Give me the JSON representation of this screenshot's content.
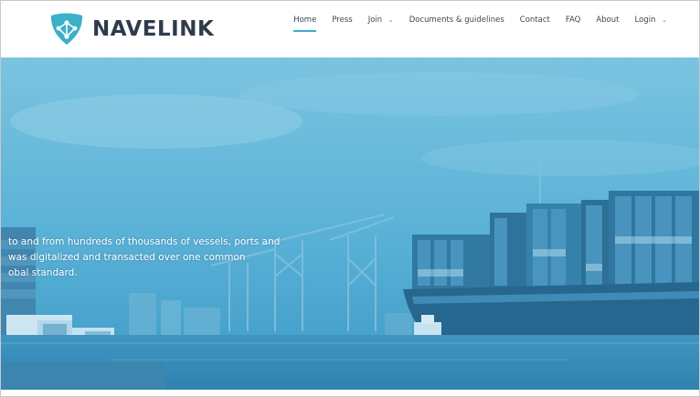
{
  "brand": {
    "name": "NAVELINK",
    "accent_color": "#3bb0c9",
    "text_color": "#2e3b4a"
  },
  "nav": {
    "items": [
      {
        "label": "Home",
        "active": true,
        "dropdown": false
      },
      {
        "label": "Press",
        "active": false,
        "dropdown": false
      },
      {
        "label": "Join",
        "active": false,
        "dropdown": true
      },
      {
        "label": "Documents & guidelines",
        "active": false,
        "dropdown": false
      },
      {
        "label": "Contact",
        "active": false,
        "dropdown": false
      },
      {
        "label": "FAQ",
        "active": false,
        "dropdown": false
      },
      {
        "label": "About",
        "active": false,
        "dropdown": false
      },
      {
        "label": "Login",
        "active": false,
        "dropdown": true
      }
    ],
    "dropdown_icon": "chevron-down-icon"
  },
  "hero": {
    "lines": [
      "to and from hundreds of thousands of vessels, ports and",
      " was digitalized and transacted over one common",
      "obal standard."
    ],
    "overlay_color": "#4aa8d2"
  }
}
